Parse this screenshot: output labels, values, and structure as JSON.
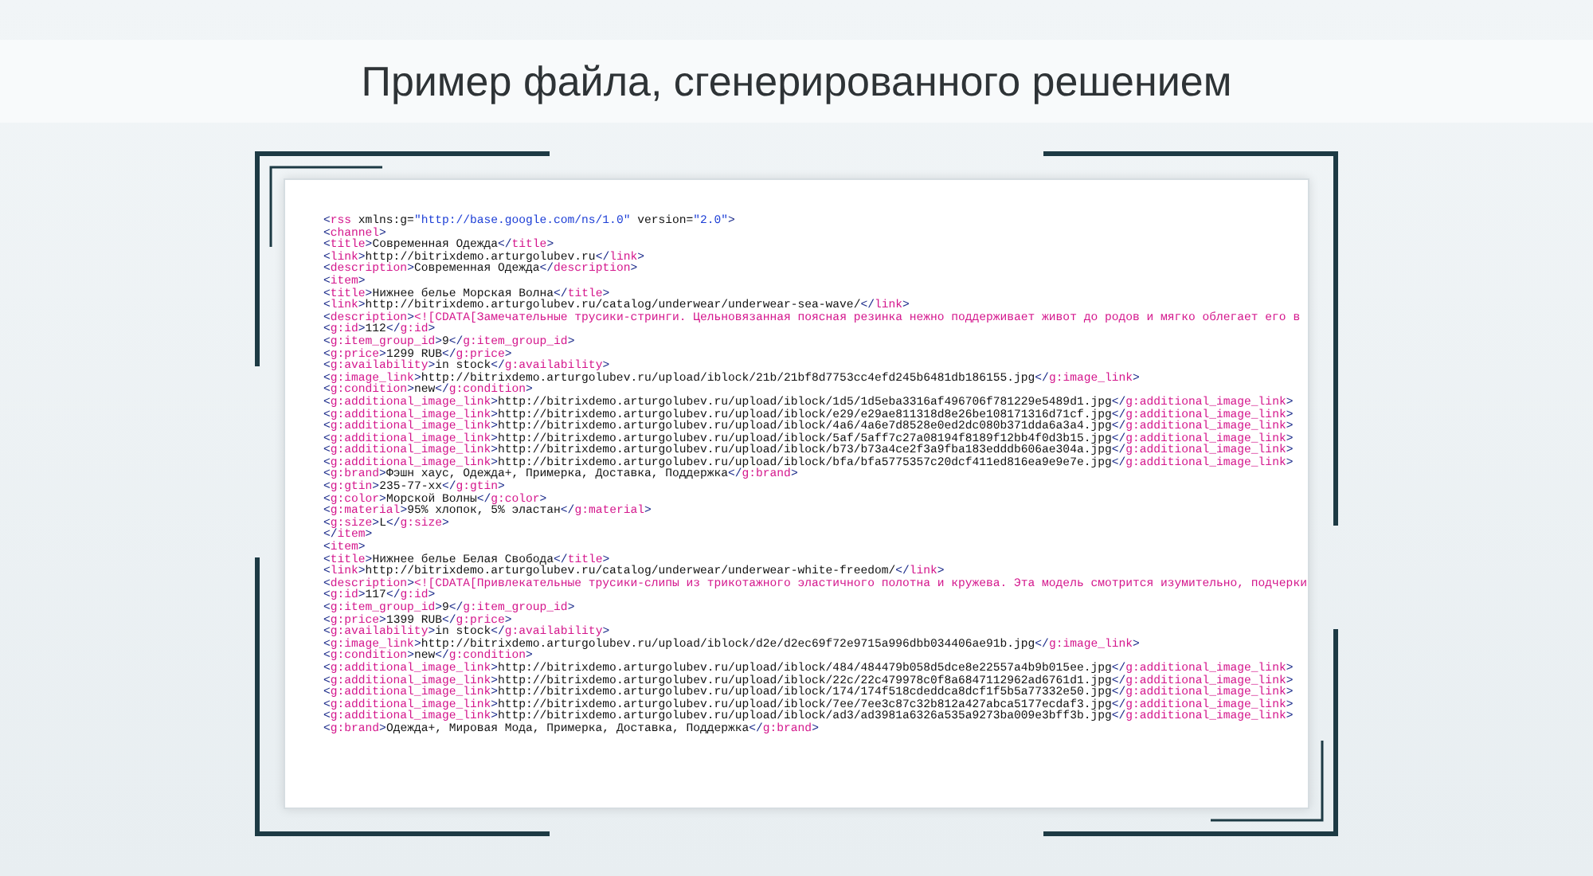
{
  "heading": "Пример файла, сгенерированного решением",
  "document": {
    "lines": [
      {
        "kind": "markup",
        "text": "<rss xmlns:g=\"http://base.google.com/ns/1.0\" version=\"2.0\">"
      },
      {
        "kind": "markup",
        "text": "<channel>"
      },
      {
        "kind": "markup",
        "text": "<title>Современная Одежда</title>"
      },
      {
        "kind": "markup",
        "text": "<link>http://bitrixdemo.arturgolubev.ru</link>"
      },
      {
        "kind": "markup",
        "text": "<description>Современная Одежда</description>"
      },
      {
        "kind": "markup",
        "text": "<item>"
      },
      {
        "kind": "markup",
        "text": "<title>Нижнее белье Морская Волна</title>"
      },
      {
        "kind": "markup",
        "text": "<link>http://bitrixdemo.arturgolubev.ru/catalog/underwear/underwear-sea-wave/</link>"
      },
      {
        "kind": "cdata",
        "text": "<description><![CDATA[Замечательные трусики-стринги. Цельновязанная поясная резинка нежно поддерживает живот до родов и мягко облегает его в"
      },
      {
        "kind": "markup",
        "text": "<g:id>112</g:id>"
      },
      {
        "kind": "markup",
        "text": "<g:item_group_id>9</g:item_group_id>"
      },
      {
        "kind": "markup",
        "text": "<g:price>1299 RUB</g:price>"
      },
      {
        "kind": "markup",
        "text": "<g:availability>in stock</g:availability>"
      },
      {
        "kind": "markup",
        "text": "<g:image_link>http://bitrixdemo.arturgolubev.ru/upload/iblock/21b/21bf8d7753cc4efd245b6481db186155.jpg</g:image_link>"
      },
      {
        "kind": "markup",
        "text": "<g:condition>new</g:condition>"
      },
      {
        "kind": "markup",
        "text": "<g:additional_image_link>http://bitrixdemo.arturgolubev.ru/upload/iblock/1d5/1d5eba3316af496706f781229e5489d1.jpg</g:additional_image_link>"
      },
      {
        "kind": "markup",
        "text": "<g:additional_image_link>http://bitrixdemo.arturgolubev.ru/upload/iblock/e29/e29ae811318d8e26be108171316d71cf.jpg</g:additional_image_link>"
      },
      {
        "kind": "markup",
        "text": "<g:additional_image_link>http://bitrixdemo.arturgolubev.ru/upload/iblock/4a6/4a6e7d8528e0ed2dc080b371dda6a3a4.jpg</g:additional_image_link>"
      },
      {
        "kind": "markup",
        "text": "<g:additional_image_link>http://bitrixdemo.arturgolubev.ru/upload/iblock/5af/5aff7c27a08194f8189f12bb4f0d3b15.jpg</g:additional_image_link>"
      },
      {
        "kind": "markup",
        "text": "<g:additional_image_link>http://bitrixdemo.arturgolubev.ru/upload/iblock/b73/b73a4ce2f3a9fba183edddb606ae304a.jpg</g:additional_image_link>"
      },
      {
        "kind": "markup",
        "text": "<g:additional_image_link>http://bitrixdemo.arturgolubev.ru/upload/iblock/bfa/bfa5775357c20dcf411ed816ea9e9e7e.jpg</g:additional_image_link>"
      },
      {
        "kind": "markup",
        "text": "<g:brand>Фэшн хаус, Одежда+, Примерка, Доставка, Поддержка</g:brand>"
      },
      {
        "kind": "markup",
        "text": "<g:gtin>235-77-xx</g:gtin>"
      },
      {
        "kind": "markup",
        "text": "<g:color>Морской Волны</g:color>"
      },
      {
        "kind": "markup",
        "text": "<g:material>95% хлопок, 5% эластан</g:material>"
      },
      {
        "kind": "markup",
        "text": "<g:size>L</g:size>"
      },
      {
        "kind": "markup",
        "text": "</item>"
      },
      {
        "kind": "markup",
        "text": "<item>"
      },
      {
        "kind": "markup",
        "text": "<title>Нижнее белье Белая Свобода</title>"
      },
      {
        "kind": "markup",
        "text": "<link>http://bitrixdemo.arturgolubev.ru/catalog/underwear/underwear-white-freedom/</link>"
      },
      {
        "kind": "cdata",
        "text": "<description><![CDATA[Привлекательные трусики-слипы из трикотажного эластичного полотна и кружева. Эта модель смотрится изумительно, подчерки"
      },
      {
        "kind": "markup",
        "text": "<g:id>117</g:id>"
      },
      {
        "kind": "markup",
        "text": "<g:item_group_id>9</g:item_group_id>"
      },
      {
        "kind": "markup",
        "text": "<g:price>1399 RUB</g:price>"
      },
      {
        "kind": "markup",
        "text": "<g:availability>in stock</g:availability>"
      },
      {
        "kind": "markup",
        "text": "<g:image_link>http://bitrixdemo.arturgolubev.ru/upload/iblock/d2e/d2ec69f72e9715a996dbb034406ae91b.jpg</g:image_link>"
      },
      {
        "kind": "markup",
        "text": "<g:condition>new</g:condition>"
      },
      {
        "kind": "markup",
        "text": "<g:additional_image_link>http://bitrixdemo.arturgolubev.ru/upload/iblock/484/484479b058d5dce8e22557a4b9b015ee.jpg</g:additional_image_link>"
      },
      {
        "kind": "markup",
        "text": "<g:additional_image_link>http://bitrixdemo.arturgolubev.ru/upload/iblock/22c/22c479978c0f8a6847112962ad6761d1.jpg</g:additional_image_link>"
      },
      {
        "kind": "markup",
        "text": "<g:additional_image_link>http://bitrixdemo.arturgolubev.ru/upload/iblock/174/174f518cdeddca8dcf1f5b5a77332e50.jpg</g:additional_image_link>"
      },
      {
        "kind": "markup",
        "text": "<g:additional_image_link>http://bitrixdemo.arturgolubev.ru/upload/iblock/7ee/7ee3c87c32b812a427abca5177ecdaf3.jpg</g:additional_image_link>"
      },
      {
        "kind": "markup",
        "text": "<g:additional_image_link>http://bitrixdemo.arturgolubev.ru/upload/iblock/ad3/ad3981a6326a535a9273ba009e3bff3b.jpg</g:additional_image_link>"
      },
      {
        "kind": "markup",
        "text": "<g:brand>Одежда+, Мировая Мода, Примерка, Доставка, Поддержка</g:brand>"
      }
    ]
  }
}
